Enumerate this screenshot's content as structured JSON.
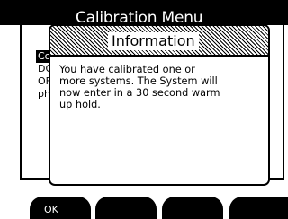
{
  "window": {
    "title": "Calibration Menu"
  },
  "menu": {
    "items": [
      {
        "label": "Co",
        "selected": true
      },
      {
        "label": "DO",
        "selected": false
      },
      {
        "label": "OF",
        "selected": false
      },
      {
        "label": "ph",
        "selected": false
      }
    ]
  },
  "dialog": {
    "title": "Information",
    "message_lines": [
      "You have calibrated one or",
      "more systems. The System will",
      "now enter in a 30 second warm",
      "up hold."
    ]
  },
  "softkeys": [
    {
      "label": "OK"
    },
    {
      "label": ""
    },
    {
      "label": ""
    },
    {
      "label": ""
    }
  ],
  "colors": {
    "foreground": "#000000",
    "background": "#ffffff"
  }
}
